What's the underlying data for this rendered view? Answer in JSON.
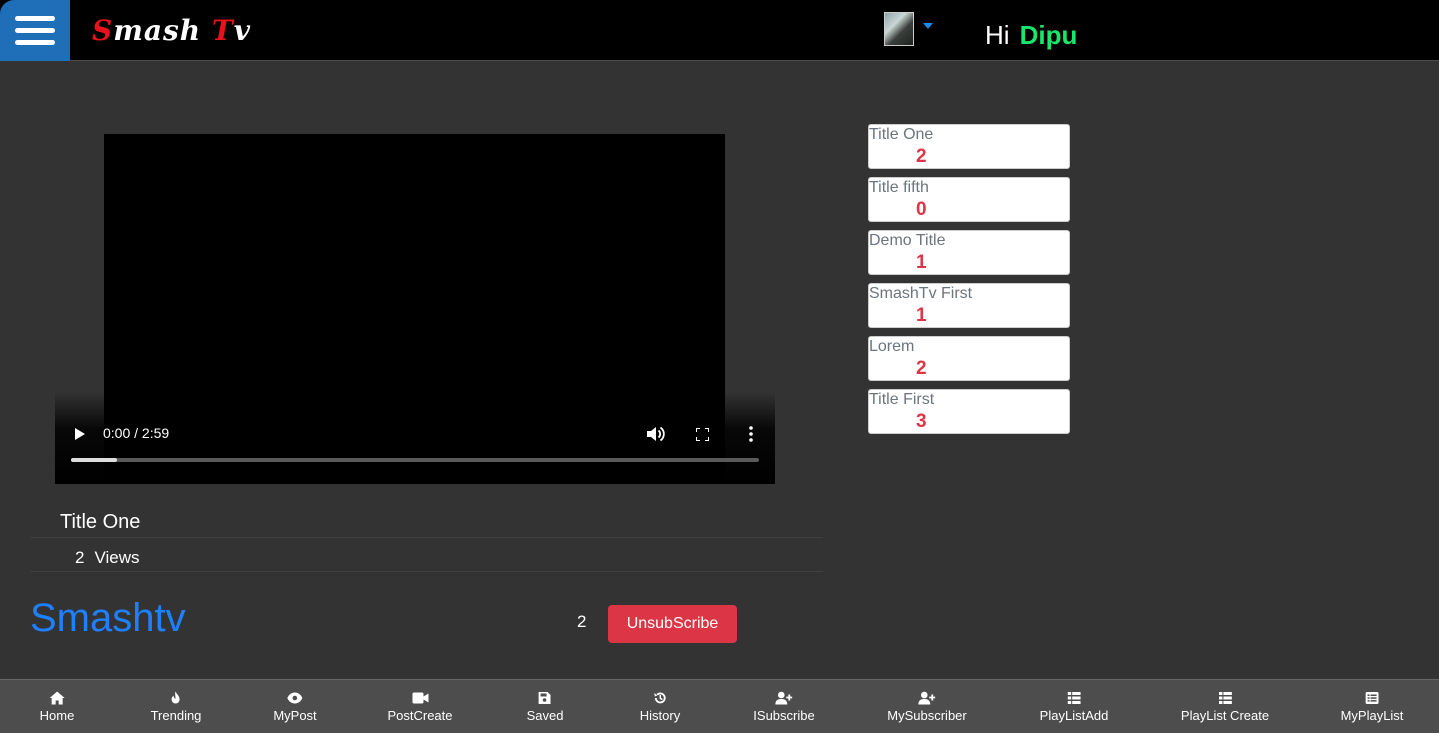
{
  "header": {
    "brand_first": "S",
    "brand_mid": "mash ",
    "brand_t": "T",
    "brand_end": "v",
    "greeting": "Hi",
    "user_name": "Dipu"
  },
  "video": {
    "time": "0:00 / 2:59",
    "progress_fraction": 0.067,
    "title": "Title One",
    "views_count": "2",
    "views_label": "Views"
  },
  "channel": {
    "name": "Smashtv",
    "subscriber_count": "2",
    "unsubscribe_label": "UnsubScribe"
  },
  "playlist": [
    {
      "title": "Title One",
      "count": "2"
    },
    {
      "title": "Title fifth",
      "count": "0"
    },
    {
      "title": "Demo Title",
      "count": "1"
    },
    {
      "title": "SmashTv First",
      "count": "1"
    },
    {
      "title": "Lorem",
      "count": "2"
    },
    {
      "title": "Title First",
      "count": "3"
    }
  ],
  "bottom_nav": [
    {
      "label": "Home",
      "icon": "home-icon"
    },
    {
      "label": "Trending",
      "icon": "fire-icon"
    },
    {
      "label": "MyPost",
      "icon": "eye-icon"
    },
    {
      "label": "PostCreate",
      "icon": "video-camera-icon"
    },
    {
      "label": "Saved",
      "icon": "save-icon"
    },
    {
      "label": "History",
      "icon": "history-icon"
    },
    {
      "label": "ISubscribe",
      "icon": "user-plus-icon"
    },
    {
      "label": "MySubscriber",
      "icon": "user-plus-icon"
    },
    {
      "label": "PlayListAdd",
      "icon": "list-grid-icon"
    },
    {
      "label": "PlayList Create",
      "icon": "list-grid-icon"
    },
    {
      "label": "MyPlayList",
      "icon": "list-alt-icon"
    }
  ],
  "colors": {
    "menu_button": "#1e6fb8",
    "brand_red": "#e8121d",
    "user_name": "#19e66b",
    "channel_link": "#1e80ff",
    "danger": "#dc3545",
    "background": "#333333"
  }
}
